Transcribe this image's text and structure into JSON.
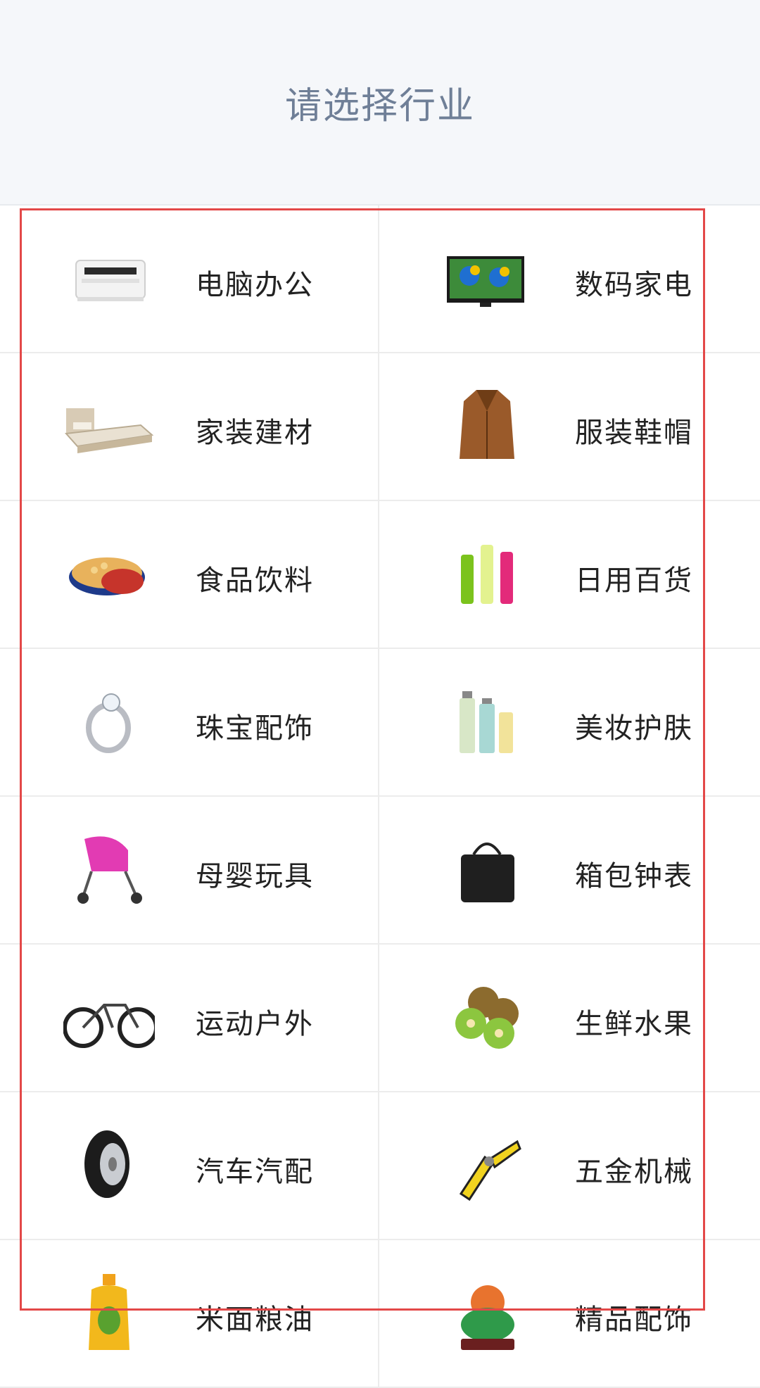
{
  "header": {
    "title": "请选择行业"
  },
  "industries": [
    {
      "label": "电脑办公",
      "icon": "printer-icon"
    },
    {
      "label": "数码家电",
      "icon": "tv-icon"
    },
    {
      "label": "家装建材",
      "icon": "bed-icon"
    },
    {
      "label": "服装鞋帽",
      "icon": "coat-icon"
    },
    {
      "label": "食品饮料",
      "icon": "cookie-tin-icon"
    },
    {
      "label": "日用百货",
      "icon": "bottles-icon"
    },
    {
      "label": "珠宝配饰",
      "icon": "ring-icon"
    },
    {
      "label": "美妆护肤",
      "icon": "cosmetics-icon"
    },
    {
      "label": "母婴玩具",
      "icon": "stroller-icon"
    },
    {
      "label": "箱包钟表",
      "icon": "handbag-icon"
    },
    {
      "label": "运动户外",
      "icon": "bicycle-icon"
    },
    {
      "label": "生鲜水果",
      "icon": "kiwi-icon"
    },
    {
      "label": "汽车汽配",
      "icon": "tire-icon"
    },
    {
      "label": "五金机械",
      "icon": "pliers-icon"
    },
    {
      "label": "米面粮油",
      "icon": "oil-bottle-icon"
    },
    {
      "label": "精品配饰",
      "icon": "jade-ornament-icon"
    }
  ],
  "colors": {
    "header_bg": "#f5f7fa",
    "title": "#6f7f97",
    "selection_border": "#e34848"
  }
}
